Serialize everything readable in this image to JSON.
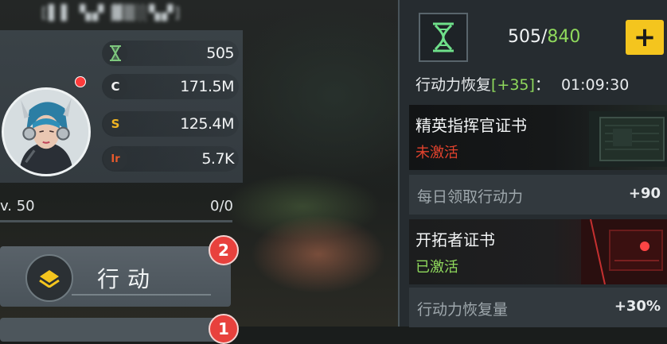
{
  "player": {
    "name": "[▌▌ ▚▞ ▓▒░▚▞]",
    "level": "v. 50",
    "exp": "0/0",
    "exp_progress": 0
  },
  "stats": [
    {
      "icon": "hourglass-icon",
      "glyph": "⧗",
      "color": "#7ec87e",
      "value": "505"
    },
    {
      "icon": "credit-coin-icon",
      "glyph": "C",
      "color": "#f2f2f2",
      "value": "171.5M"
    },
    {
      "icon": "gold-coin-icon",
      "glyph": "S",
      "color": "#f2b522",
      "value": "125.4M"
    },
    {
      "icon": "premium-currency-icon",
      "glyph": "Ir",
      "color": "#e85a2c",
      "value": "5.7K"
    }
  ],
  "action_button": {
    "label": "行动",
    "badge": "2"
  },
  "second_button": {
    "badge": "1"
  },
  "stamina": {
    "current": "505",
    "separator": "/",
    "max": "840",
    "add_label": "+"
  },
  "recovery": {
    "label": "行动力恢复",
    "rate": "[+35]",
    "colon": "：",
    "time": "01:09:30"
  },
  "elite_card": {
    "title": "精英指挥官证书",
    "status": "未激活"
  },
  "daily_bonus": {
    "label": "每日领取行动力",
    "value": "+90"
  },
  "pioneer_card": {
    "title": "开拓者证书",
    "status": "已激活"
  },
  "recovery_bonus": {
    "label": "行动力恢复量",
    "value": "+30%"
  },
  "colors": {
    "accent_green": "#8fd95c",
    "accent_yellow": "#f4c51e",
    "inactive_red": "#e2422d",
    "badge_red": "#e8413d"
  }
}
